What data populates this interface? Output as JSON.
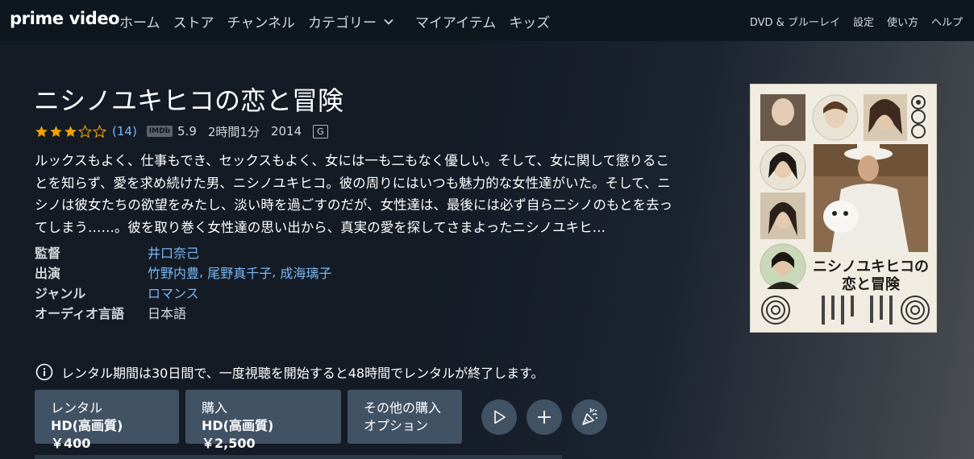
{
  "nav": {
    "logo": "prime video",
    "main": [
      "ホーム",
      "ストア",
      "チャンネル"
    ],
    "categories": "カテゴリー",
    "main2": [
      "マイアイテム",
      "キッズ"
    ],
    "right": [
      "DVD & ブルーレイ",
      "設定",
      "使い方",
      "ヘルプ"
    ]
  },
  "movie": {
    "title": "ニシノユキヒコの恋と冒険",
    "rating_stars": 3,
    "review_count": "(14)",
    "imdb_label": "IMDb",
    "imdb_score": "5.9",
    "duration": "2時間1分",
    "year": "2014",
    "age_rating": "G",
    "synopsis": "ルックスもよく、仕事もでき、セックスもよく、女には一も二もなく優しい。そして、女に関して懲りることを知らず、愛を求め続けた男、ニシノユキヒコ。彼の周りにはいつも魅力的な女性達がいた。そして、ニシノは彼女たちの欲望をみたし、淡い時を過ごすのだが、女性達は、最後には必ず自ら二シノのもとを去ってしまう……。彼を取り巻く女性達の思い出から、真実の愛を探してさまよったニシノユキヒ…"
  },
  "details": {
    "director_label": "監督",
    "director": "井口奈己",
    "cast_label": "出演",
    "cast": [
      "竹野内豊",
      "尾野真千子",
      "成海璃子"
    ],
    "genre_label": "ジャンル",
    "genre": "ロマンス",
    "audio_label": "オーディオ言語",
    "audio": "日本語"
  },
  "poster": {
    "title_line1": "ニシノユキヒコの",
    "title_line2": "恋と冒険"
  },
  "notice": "レンタル期間は30日間で、一度視聴を開始すると48時間でレンタルが終了します。",
  "buttons": {
    "rent_line1": "レンタル",
    "rent_line2": "HD(高画質) ￥400",
    "buy_line1": "購入",
    "buy_line2": "HD(高画質) ￥2,500",
    "other_line1": "その他の購入",
    "other_line2": "オプション"
  },
  "colors": {
    "background": "#141b25",
    "nav_bg": "#0f171e",
    "button": "#425265",
    "link": "#79b8f3",
    "star": "#f2a200"
  },
  "icons": [
    "chevron-down-icon",
    "star-icon",
    "info-icon",
    "play-icon",
    "plus-icon",
    "party-icon"
  ]
}
